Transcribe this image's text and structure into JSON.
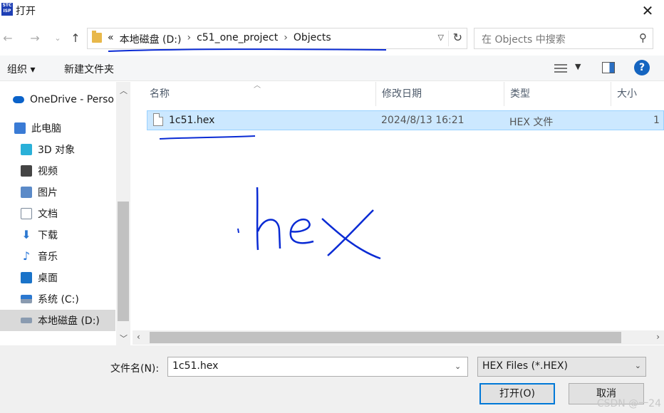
{
  "window": {
    "title": "打开",
    "app_icon_text": "STC ISP"
  },
  "nav": {
    "breadcrumbs": [
      "本地磁盘 (D:)",
      "c51_one_project",
      "Objects"
    ],
    "overflow": "«",
    "search_placeholder": "在 Objects 中搜索"
  },
  "toolbar": {
    "organize": "组织 ▾",
    "new_folder": "新建文件夹"
  },
  "sidebar": {
    "items": [
      {
        "label": "OneDrive - Perso",
        "icon": "onedrive-icon",
        "color": "#0a62c9"
      },
      {
        "label": "此电脑",
        "icon": "computer-icon",
        "color": "#3a7bd5"
      },
      {
        "label": "3D 对象",
        "icon": "3d-objects-icon",
        "color": "#2ab0d8"
      },
      {
        "label": "视频",
        "icon": "video-icon",
        "color": "#444"
      },
      {
        "label": "图片",
        "icon": "pictures-icon",
        "color": "#5b8ac8"
      },
      {
        "label": "文档",
        "icon": "documents-icon",
        "color": "#7a8899"
      },
      {
        "label": "下载",
        "icon": "downloads-icon",
        "color": "#2b78d0"
      },
      {
        "label": "音乐",
        "icon": "music-icon",
        "color": "#1b6ed6"
      },
      {
        "label": "桌面",
        "icon": "desktop-icon",
        "color": "#1a73c9"
      },
      {
        "label": "系统 (C:)",
        "icon": "drive-c-icon",
        "color": "#8a9bb0"
      },
      {
        "label": "本地磁盘 (D:)",
        "icon": "drive-d-icon",
        "color": "#8a9bb0"
      }
    ],
    "selected_index": 10
  },
  "columns": [
    "名称",
    "修改日期",
    "类型",
    "大小"
  ],
  "files": [
    {
      "name": "1c51.hex",
      "modified": "2024/8/13 16:21",
      "type": "HEX 文件",
      "size": "1"
    }
  ],
  "bottom": {
    "filename_label": "文件名(N):",
    "filename_value": "1c51.hex",
    "filetype": "HEX Files (*.HEX)",
    "open_button": "打开(O)",
    "cancel_button": "取消"
  },
  "annotation": {
    "handwritten_text": ".hex",
    "ink_color": "#0a2bd4"
  },
  "watermark": "CSDN @一24"
}
